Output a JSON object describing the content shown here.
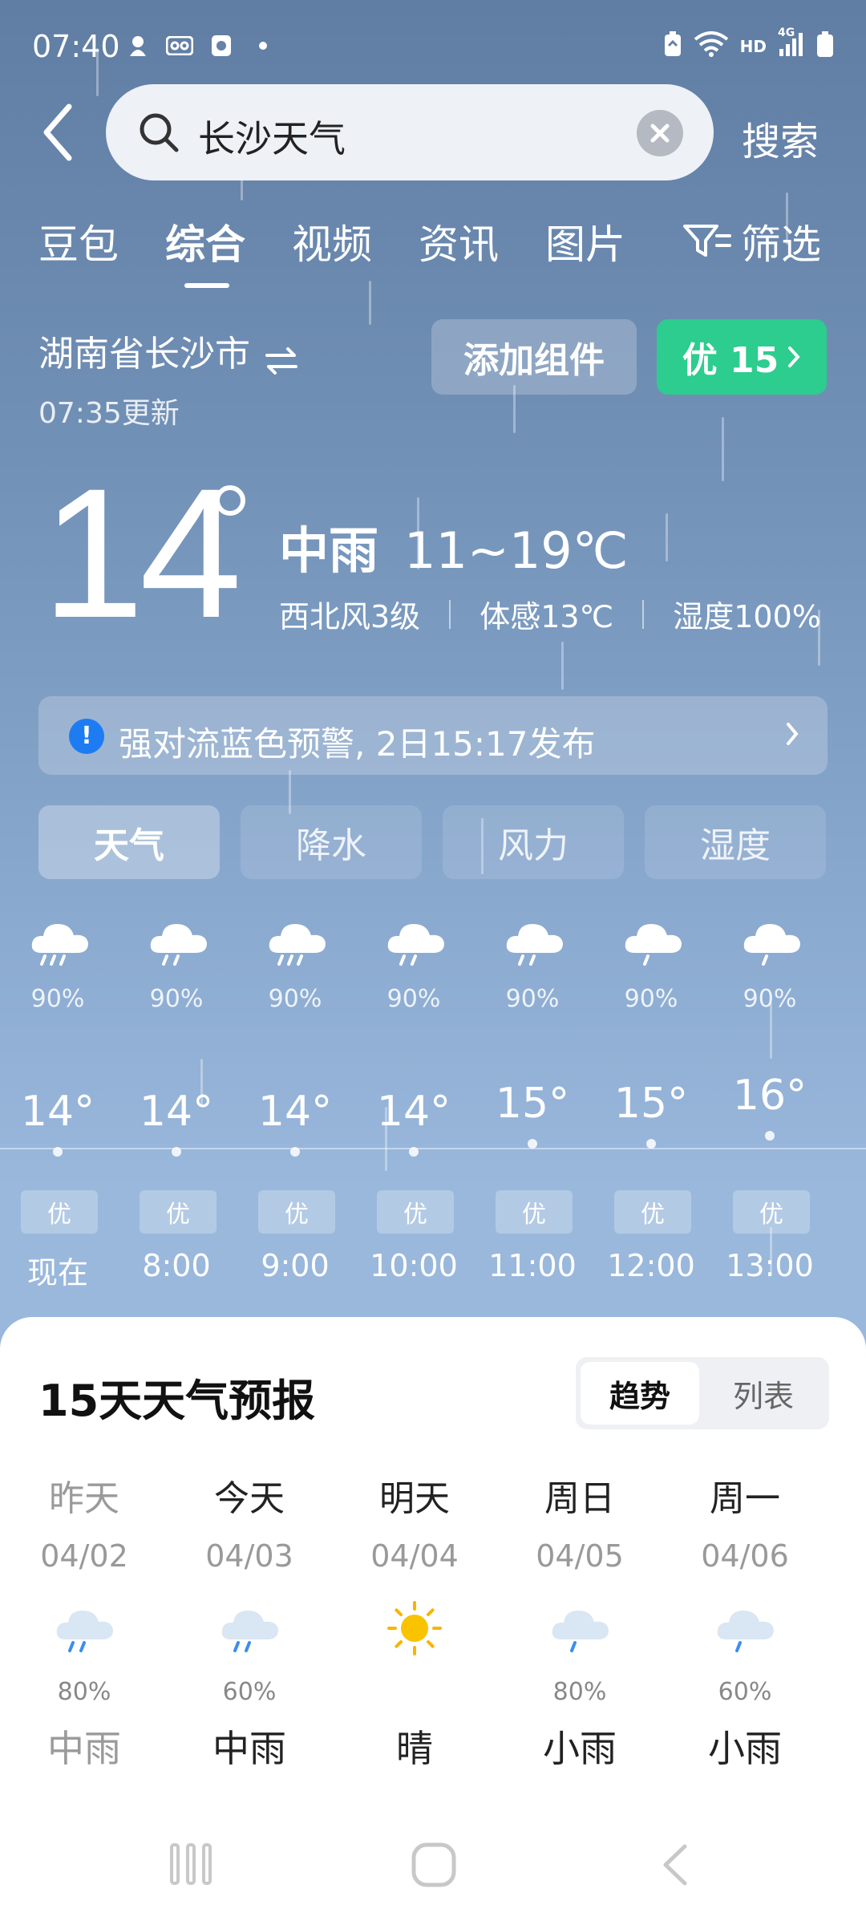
{
  "status_bar": {
    "time": "07:40",
    "left_icons": [
      "notification-icon",
      "voicemail-icon",
      "app-icon",
      "dot-icon"
    ],
    "right_icons": [
      "battery-saver-icon",
      "wifi-icon",
      "hd-icon",
      "signal-icon",
      "battery-icon"
    ],
    "hd_label": "HD",
    "network_label": "4G"
  },
  "search": {
    "query": "长沙天气",
    "button_label": "搜索"
  },
  "tabs": [
    {
      "label": "豆包"
    },
    {
      "label": "综合",
      "active": true
    },
    {
      "label": "视频"
    },
    {
      "label": "资讯"
    },
    {
      "label": "图片"
    }
  ],
  "filter_label": "筛选",
  "location": {
    "name": "湖南省长沙市",
    "updated": "07:35更新"
  },
  "add_widget_label": "添加组件",
  "aqi_badge": "优 15",
  "current": {
    "temp": "14",
    "condition": "中雨",
    "range": "11~19℃",
    "wind": "西北风3级",
    "feels_like": "体感13℃",
    "humidity": "湿度100%"
  },
  "alert": {
    "text": "强对流蓝色预警, 2日15:17发布"
  },
  "metric_tabs": [
    {
      "label": "天气",
      "active": true
    },
    {
      "label": "降水"
    },
    {
      "label": "风力"
    },
    {
      "label": "湿度"
    }
  ],
  "hourly": [
    {
      "time": "现在",
      "pop": "90%",
      "temp": "14°",
      "temp_value": 14,
      "aqi": "优",
      "icon": "heavy-rain-cloud-icon"
    },
    {
      "time": "8:00",
      "pop": "90%",
      "temp": "14°",
      "temp_value": 14,
      "aqi": "优",
      "icon": "light-rain-cloud-icon"
    },
    {
      "time": "9:00",
      "pop": "90%",
      "temp": "14°",
      "temp_value": 14,
      "aqi": "优",
      "icon": "heavy-rain-cloud-icon"
    },
    {
      "time": "10:00",
      "pop": "90%",
      "temp": "14°",
      "temp_value": 14,
      "aqi": "优",
      "icon": "light-rain-cloud-icon"
    },
    {
      "time": "11:00",
      "pop": "90%",
      "temp": "15°",
      "temp_value": 15,
      "aqi": "优",
      "icon": "light-rain-cloud-icon"
    },
    {
      "time": "12:00",
      "pop": "90%",
      "temp": "15°",
      "temp_value": 15,
      "aqi": "优",
      "icon": "drizzle-cloud-icon"
    },
    {
      "time": "13:00",
      "pop": "90%",
      "temp": "16°",
      "temp_value": 16,
      "aqi": "优",
      "icon": "drizzle-cloud-icon"
    }
  ],
  "forecast": {
    "title": "15天天气预报",
    "toggle": {
      "trend": "趋势",
      "list": "列表"
    },
    "days": [
      {
        "name": "昨天",
        "date": "04/02",
        "pop": "80%",
        "cond": "中雨",
        "icon": "rain-cloud-icon",
        "past": true
      },
      {
        "name": "今天",
        "date": "04/03",
        "pop": "60%",
        "cond": "中雨",
        "icon": "rain-cloud-icon"
      },
      {
        "name": "明天",
        "date": "04/04",
        "pop": "",
        "cond": "晴",
        "icon": "sun-icon"
      },
      {
        "name": "周日",
        "date": "04/05",
        "pop": "80%",
        "cond": "小雨",
        "icon": "light-rain-cloud-icon"
      },
      {
        "name": "周一",
        "date": "04/06",
        "pop": "60%",
        "cond": "小雨",
        "icon": "light-rain-cloud-icon"
      }
    ]
  },
  "colors": {
    "aqi_green": "#2dcc8f",
    "alert_blue": "#1e7cf2",
    "sky_top": "#607da3",
    "sky_bottom": "#9ab8dc"
  }
}
